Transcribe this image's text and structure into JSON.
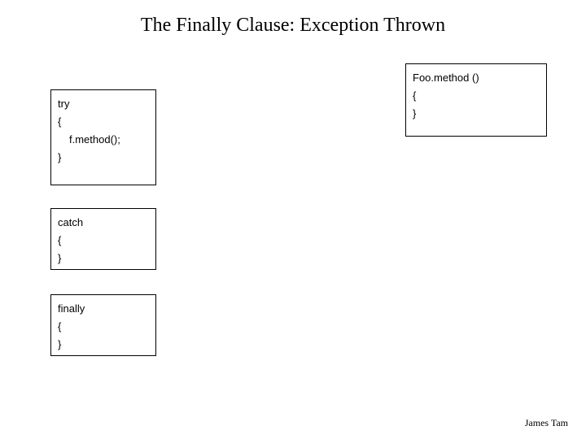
{
  "title": "The Finally Clause: Exception Thrown",
  "tryBox": {
    "line1": "try",
    "line2": "{",
    "line3": "f.method();",
    "line4": "}"
  },
  "catchBox": {
    "line1": "catch",
    "line2": "{",
    "line3": "}"
  },
  "finallyBox": {
    "line1": "finally",
    "line2": "{",
    "line3": "}"
  },
  "fooBox": {
    "line1": "Foo.method ()",
    "line2": "{",
    "line3": "}"
  },
  "footer": "James Tam"
}
